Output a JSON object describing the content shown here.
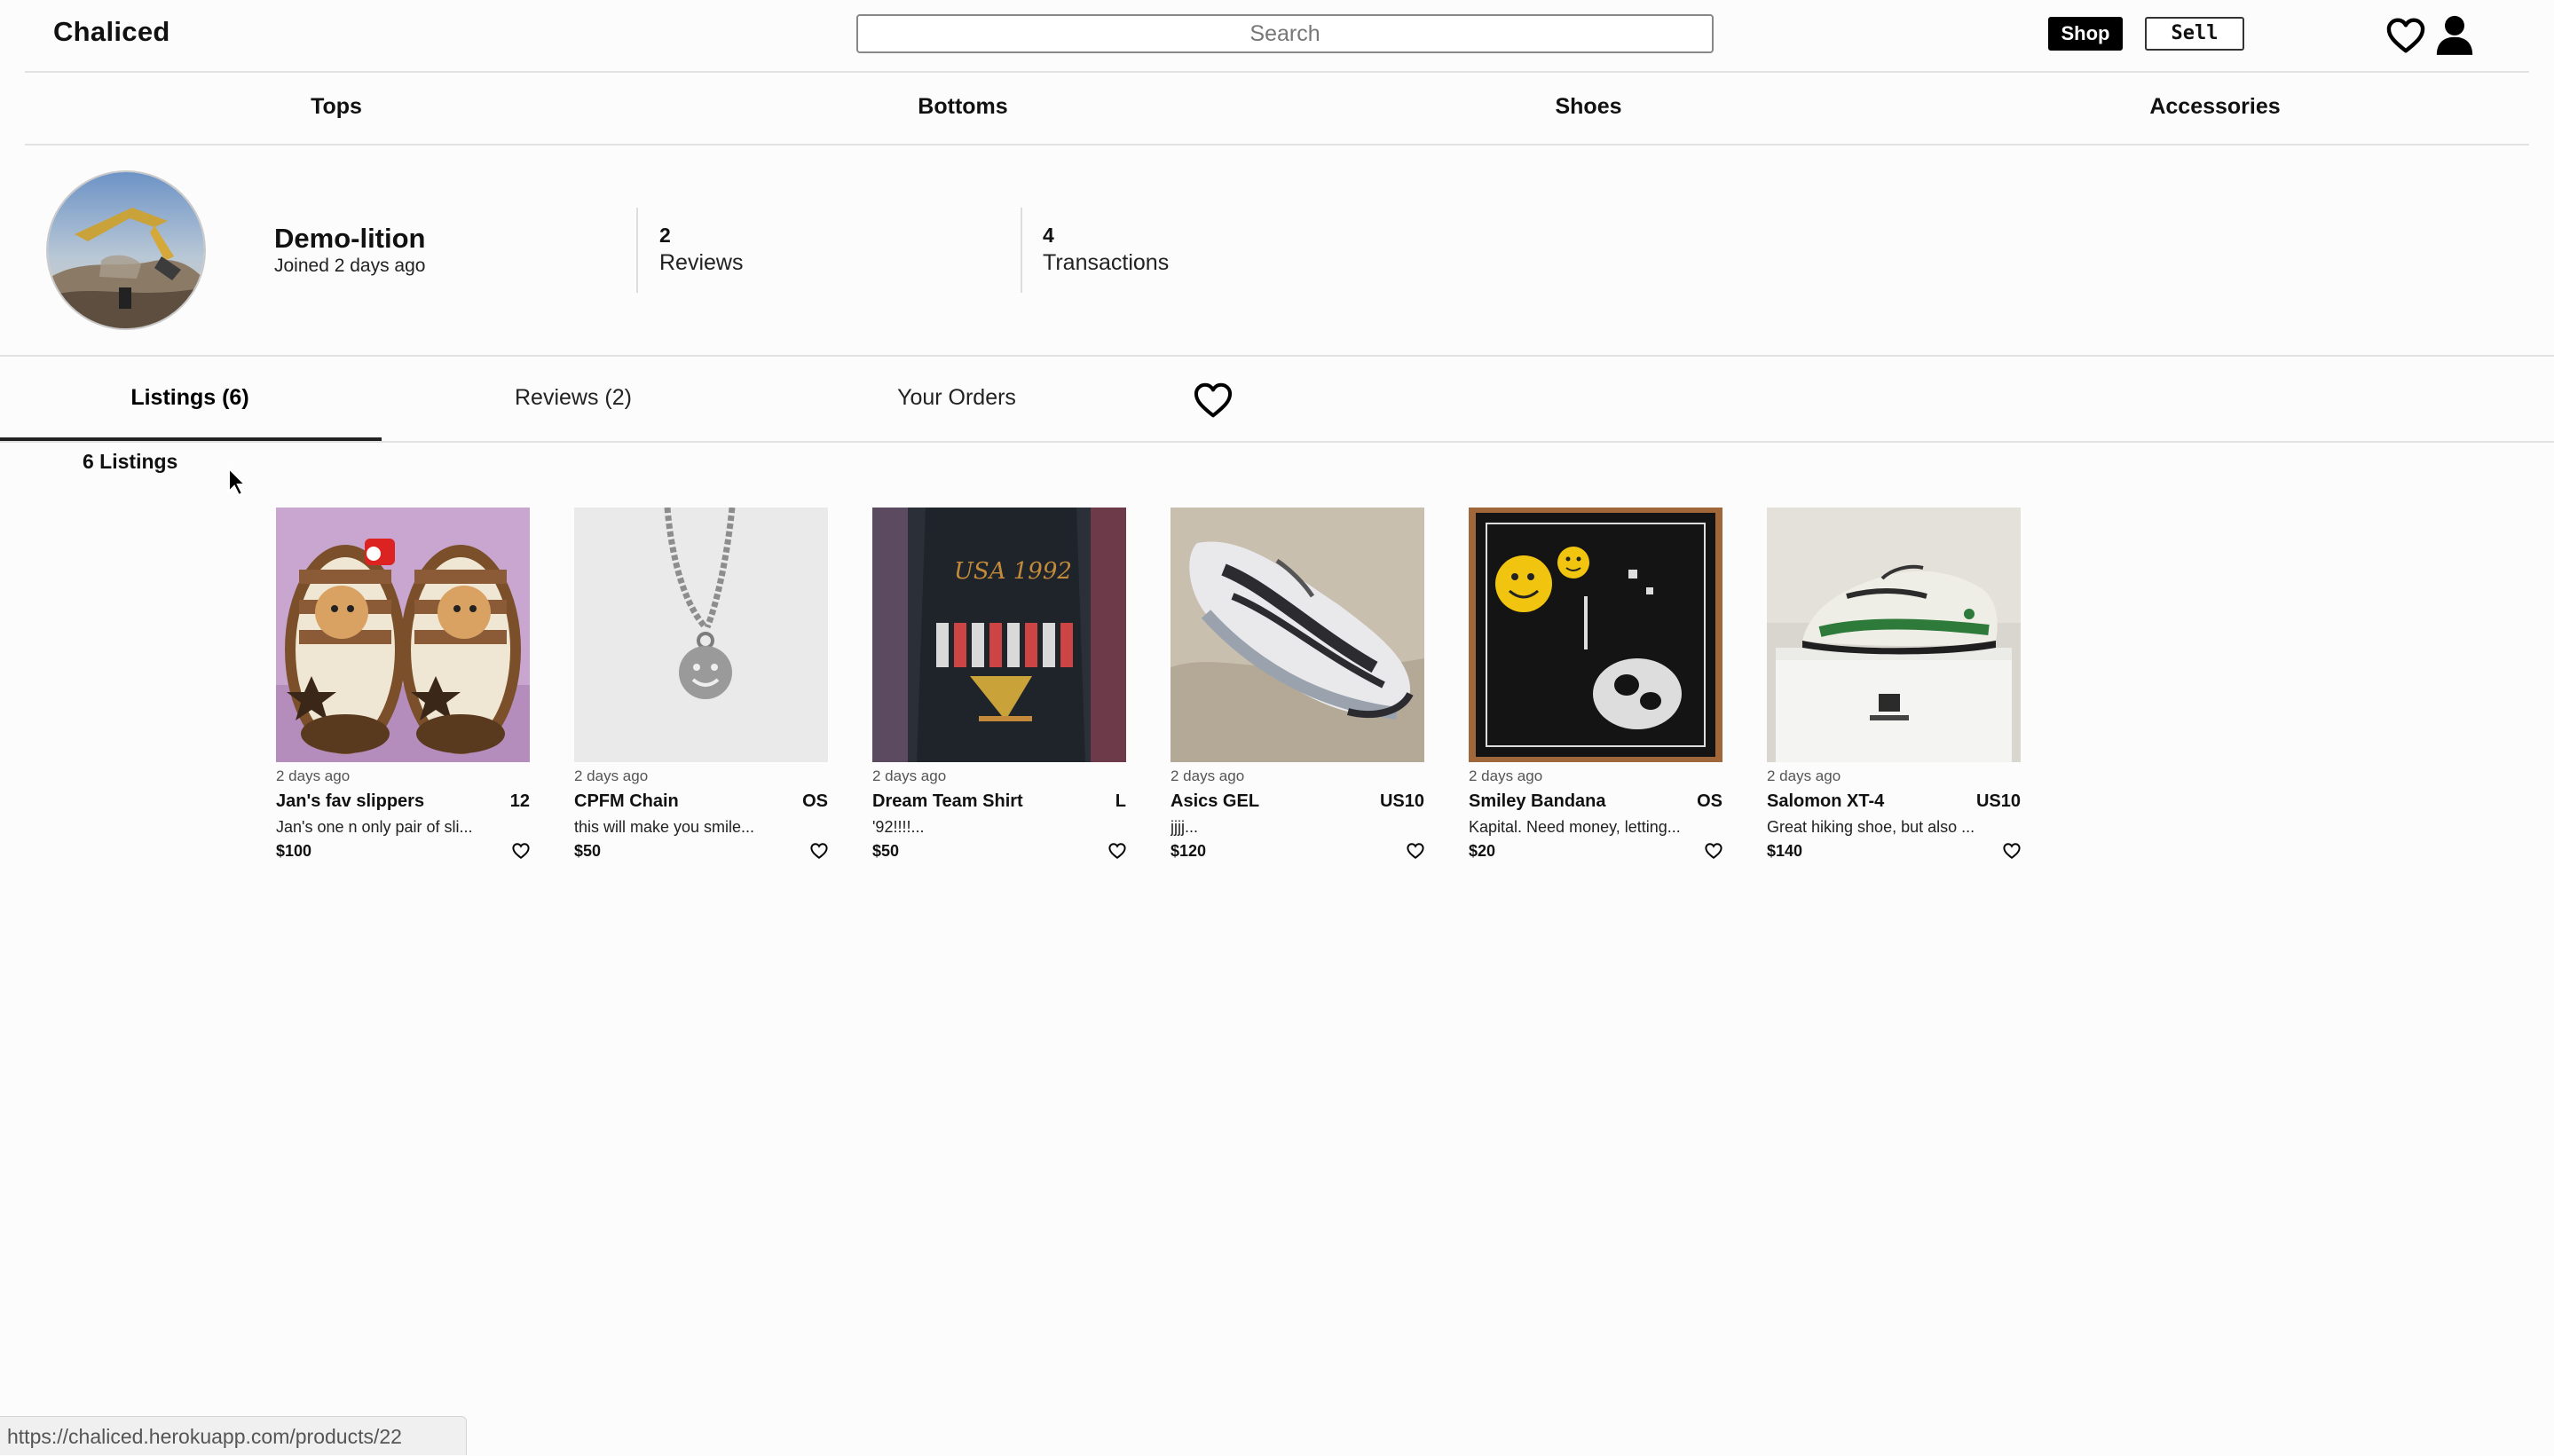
{
  "brand": "Chaliced",
  "search": {
    "placeholder": "Search"
  },
  "header": {
    "shop_label": "Shop",
    "sell_label": "Sell"
  },
  "categories": [
    "Tops",
    "Bottoms",
    "Shoes",
    "Accessories"
  ],
  "profile": {
    "username": "Demo-lition",
    "joined": "Joined 2 days ago",
    "reviews_count": "2",
    "reviews_label": "Reviews",
    "transactions_count": "4",
    "transactions_label": "Transactions"
  },
  "tabs": {
    "listings": "Listings (6)",
    "reviews": "Reviews (2)",
    "orders": "Your Orders",
    "active": "listings"
  },
  "listings_count": "6 Listings",
  "listings": [
    {
      "ago": "2 days ago",
      "title": "Jan's fav slippers",
      "size": "12",
      "desc": "Jan's one n only pair of sli...",
      "price": "$100"
    },
    {
      "ago": "2 days ago",
      "title": "CPFM Chain",
      "size": "OS",
      "desc": "this will make you smile...",
      "price": "$50"
    },
    {
      "ago": "2 days ago",
      "title": "Dream Team Shirt",
      "size": "L",
      "desc": "'92!!!!...",
      "price": "$50"
    },
    {
      "ago": "2 days ago",
      "title": "Asics GEL",
      "size": "US10",
      "desc": "jjjj...",
      "price": "$120"
    },
    {
      "ago": "2 days ago",
      "title": "Smiley Bandana",
      "size": "OS",
      "desc": "Kapital. Need money, letting...",
      "price": "$20"
    },
    {
      "ago": "2 days ago",
      "title": "Salomon XT-4",
      "size": "US10",
      "desc": "Great hiking shoe, but also ...",
      "price": "$140"
    }
  ],
  "status_url": "https://chaliced.herokuapp.com/products/22",
  "icons": {
    "header": [
      "heart-icon",
      "user-icon"
    ],
    "tabs": [
      "heart-icon"
    ],
    "cards": [
      "heart-icon"
    ]
  },
  "colors": {
    "accent": "#000000",
    "divider": "#e2e2e2",
    "background": "#fcfcfc"
  }
}
